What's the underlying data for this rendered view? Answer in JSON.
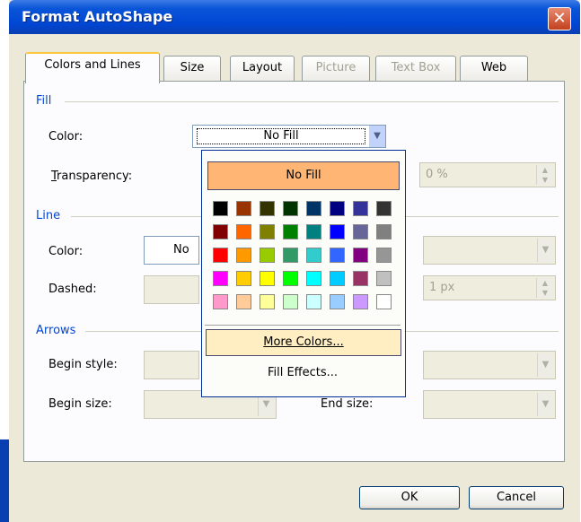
{
  "window": {
    "title": "Format AutoShape"
  },
  "tabs": [
    {
      "label": "Colors and Lines",
      "state": "active"
    },
    {
      "label": "Size",
      "state": "enabled"
    },
    {
      "label": "Layout",
      "state": "enabled"
    },
    {
      "label": "Picture",
      "state": "disabled"
    },
    {
      "label": "Text Box",
      "state": "disabled"
    },
    {
      "label": "Web",
      "state": "enabled"
    }
  ],
  "fill": {
    "heading": "Fill",
    "color_label": "Color:",
    "color_value": "No Fill",
    "transparency_label": "Transparency:",
    "transparency_value": "0 %"
  },
  "line": {
    "heading": "Line",
    "color_label": "Color:",
    "color_value": "No",
    "dashed_label": "Dashed:",
    "weight_value": "1 px"
  },
  "arrows": {
    "heading": "Arrows",
    "begin_style_label": "Begin style:",
    "begin_size_label": "Begin size:",
    "end_size_label": "End size:"
  },
  "color_popup": {
    "no_fill_label": "No Fill",
    "more_colors_label": "More Colors...",
    "fill_effects_label": "Fill Effects...",
    "swatches": [
      [
        "#000000",
        "#993300",
        "#333300",
        "#003300",
        "#003366",
        "#000080",
        "#333399",
        "#333333"
      ],
      [
        "#800000",
        "#FF6600",
        "#808000",
        "#008000",
        "#008080",
        "#0000FF",
        "#666699",
        "#808080"
      ],
      [
        "#FF0000",
        "#FF9900",
        "#99CC00",
        "#339966",
        "#33CCCC",
        "#3366FF",
        "#800080",
        "#969696"
      ],
      [
        "#FF00FF",
        "#FFCC00",
        "#FFFF00",
        "#00FF00",
        "#00FFFF",
        "#00CCFF",
        "#993366",
        "#C0C0C0"
      ],
      [
        "#FF99CC",
        "#FFCC99",
        "#FFFF99",
        "#CCFFCC",
        "#CCFFFF",
        "#99CCFF",
        "#CC99FF",
        "#FFFFFF"
      ]
    ]
  },
  "buttons": {
    "ok": "OK",
    "cancel": "Cancel"
  },
  "colors": {
    "title_bar": "#0054e3",
    "group_heading": "#0046d5",
    "popup_highlight": "#ffb574"
  }
}
